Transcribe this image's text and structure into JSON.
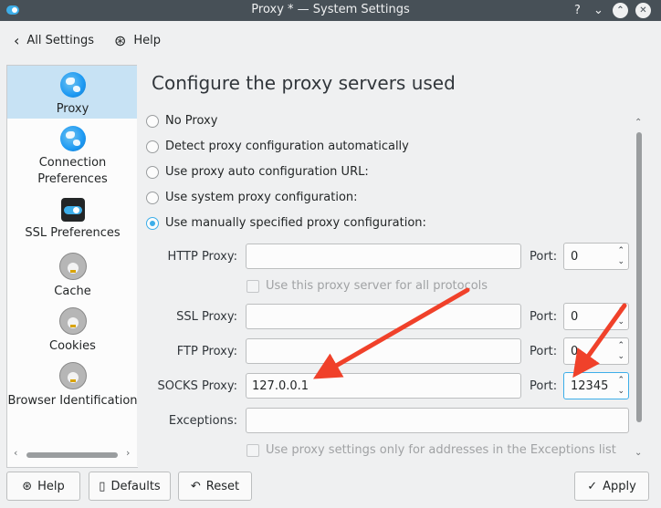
{
  "window": {
    "title": "Proxy * — System Settings"
  },
  "toolbar": {
    "back_label": "All Settings",
    "help_label": "Help"
  },
  "sidebar": {
    "items": [
      {
        "label": "Proxy"
      },
      {
        "label": "Connection Preferences"
      },
      {
        "label": "SSL Preferences"
      },
      {
        "label": "Cache"
      },
      {
        "label": "Cookies"
      },
      {
        "label": "Browser Identification"
      }
    ]
  },
  "main": {
    "title": "Configure the proxy servers used",
    "options": [
      {
        "label": "No Proxy",
        "checked": false
      },
      {
        "label": "Detect proxy configuration automatically",
        "checked": false
      },
      {
        "label": "Use proxy auto configuration URL:",
        "checked": false
      },
      {
        "label": "Use system proxy configuration:",
        "checked": false
      },
      {
        "label": "Use manually specified proxy configuration:",
        "checked": true
      }
    ],
    "port_label": "Port:",
    "http": {
      "label": "HTTP Proxy:",
      "value": "",
      "port": "0"
    },
    "use_all_label": "Use this proxy server for all protocols",
    "ssl": {
      "label": "SSL Proxy:",
      "value": "",
      "port": "0"
    },
    "ftp": {
      "label": "FTP Proxy:",
      "value": "",
      "port": "0"
    },
    "socks": {
      "label": "SOCKS Proxy:",
      "value": "127.0.0.1",
      "port": "12345"
    },
    "exceptions": {
      "label": "Exceptions:",
      "value": ""
    },
    "exceptions_only_label": "Use proxy settings only for addresses in the Exceptions list"
  },
  "buttons": {
    "help": "Help",
    "defaults": "Defaults",
    "reset": "Reset",
    "apply": "Apply"
  },
  "colors": {
    "accent": "#3daee9",
    "annotation_arrow": "#f0412a",
    "titlebar": "#475057"
  },
  "icons": [
    "app-icon",
    "help-icon",
    "minimize-icon",
    "maximize-icon",
    "close-icon",
    "back-icon",
    "globe-icon",
    "toggle-icon",
    "konqi-icon",
    "defaults-icon",
    "reset-icon",
    "check-icon"
  ]
}
